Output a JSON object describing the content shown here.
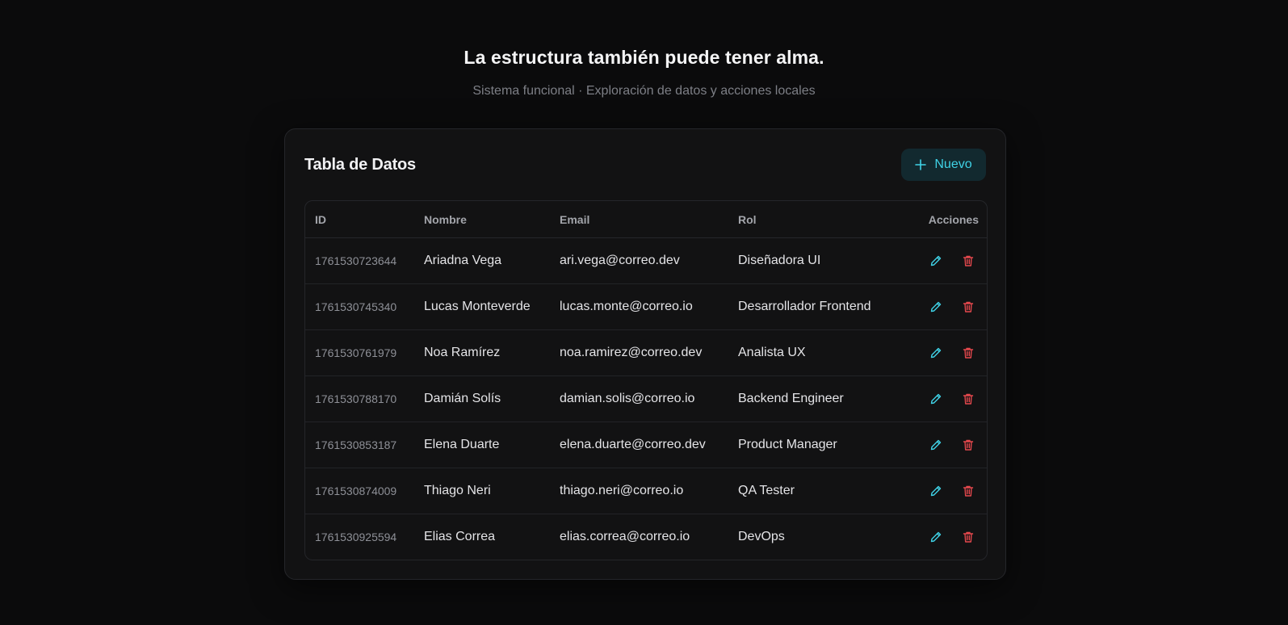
{
  "header": {
    "headline": "La estructura también puede tener alma.",
    "subline": "Sistema funcional · Exploración de datos y acciones locales"
  },
  "card": {
    "title": "Tabla de Datos",
    "new_button_label": "Nuevo",
    "new_button_icon": "plus-icon"
  },
  "table": {
    "columns": [
      "ID",
      "Nombre",
      "Email",
      "Rol",
      "Acciones"
    ],
    "rows": [
      {
        "id": "1761530723644",
        "name": "Ariadna Vega",
        "email": "ari.vega@correo.dev",
        "role": "Diseñadora UI"
      },
      {
        "id": "1761530745340",
        "name": "Lucas Monteverde",
        "email": "lucas.monte@correo.io",
        "role": "Desarrollador Frontend"
      },
      {
        "id": "1761530761979",
        "name": "Noa Ramírez",
        "email": "noa.ramirez@correo.dev",
        "role": "Analista UX"
      },
      {
        "id": "1761530788170",
        "name": "Damián Solís",
        "email": "damian.solis@correo.io",
        "role": "Backend Engineer"
      },
      {
        "id": "1761530853187",
        "name": "Elena Duarte",
        "email": "elena.duarte@correo.dev",
        "role": "Product Manager"
      },
      {
        "id": "1761530874009",
        "name": "Thiago Neri",
        "email": "thiago.neri@correo.io",
        "role": "QA Tester"
      },
      {
        "id": "1761530925594",
        "name": "Elias Correa",
        "email": "elias.correa@correo.io",
        "role": "DevOps"
      }
    ],
    "row_actions": {
      "edit_icon": "pencil-icon",
      "delete_icon": "trash-icon"
    }
  },
  "colors": {
    "background": "#0b0b0c",
    "card": "#121213",
    "accent": "#3fd2e6",
    "danger": "#e5484d"
  }
}
